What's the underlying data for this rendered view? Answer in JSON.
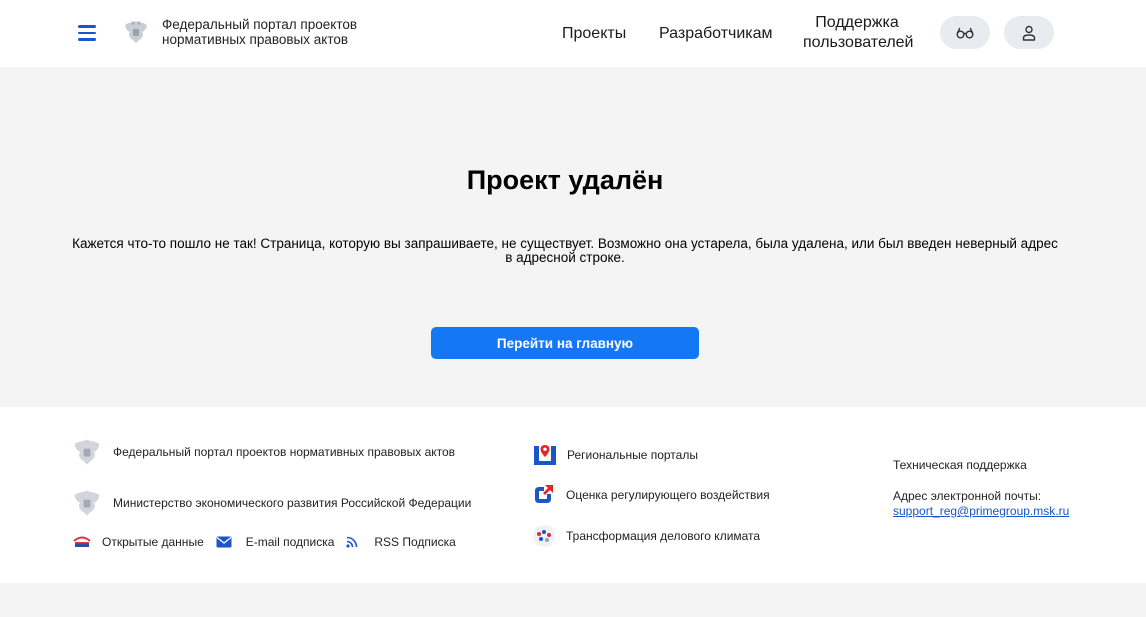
{
  "header": {
    "title_line1": "Федеральный портал проектов",
    "title_line2": "нормативных правовых актов",
    "nav": {
      "projects": "Проекты",
      "developers": "Разработчикам",
      "support_line1": "Поддержка",
      "support_line2": "пользователей"
    },
    "icons": {
      "menu": "menu-icon",
      "emblem": "coat-of-arms-icon",
      "accessibility": "glasses-icon",
      "user": "user-icon"
    }
  },
  "main": {
    "title": "Проект удалён",
    "message_line1": "Кажется что-то пошло не так! Страница, которую вы запрашиваете, не существует. Возможно она устарела, была удалена, или был введен неверный адрес",
    "message_line2": "в адресной строке.",
    "home_button": "Перейти на главную"
  },
  "footer": {
    "federal_portal": "Федеральный портал проектов нормативных правовых актов",
    "ministry": "Министерство экономического развития Российской Федерации",
    "open_data": "Открытые данные",
    "email_subscription": "E-mail подписка",
    "rss_subscription": "RSS Подписка",
    "regional_portals": "Региональные порталы",
    "regulatory_assessment": "Оценка регулирующего воздействия",
    "business_climate": "Трансформация делового климата",
    "tech_support": "Техническая поддержка",
    "email_label": "Адрес электронной почты:",
    "email": "support_reg@primegroup.msk.ru"
  },
  "colors": {
    "accent": "#1478f5",
    "nav_blue": "#1a55c9",
    "background": "#f4f4f4",
    "regional_red": "#e3262b"
  }
}
